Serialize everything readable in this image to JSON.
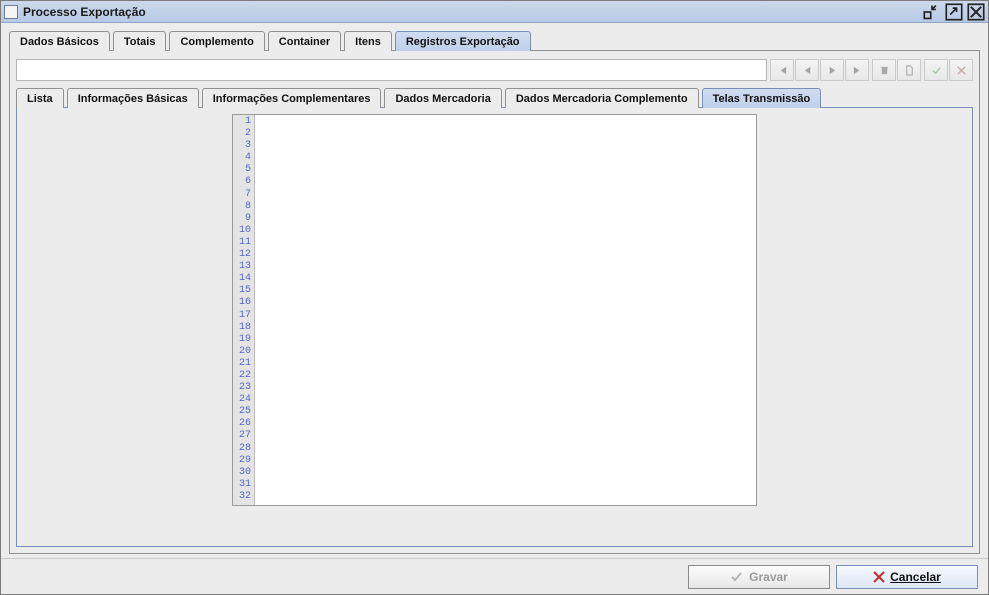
{
  "window": {
    "title": "Processo Exportação"
  },
  "mainTabs": [
    {
      "label": "Dados Básicos"
    },
    {
      "label": "Totais"
    },
    {
      "label": "Complemento"
    },
    {
      "label": "Container"
    },
    {
      "label": "Itens"
    },
    {
      "label": "Registros Exportação"
    }
  ],
  "subTabs": [
    {
      "label": "Lista"
    },
    {
      "label": "Informações Básicas"
    },
    {
      "label": "Informações Complementares"
    },
    {
      "label": "Dados Mercadoria"
    },
    {
      "label": "Dados Mercadoria Complemento"
    },
    {
      "label": "Telas Transmissão"
    }
  ],
  "editor": {
    "lineStart": 1,
    "lineEnd": 32,
    "content": ""
  },
  "footer": {
    "saveLabel": "Gravar",
    "cancelLabel": "Cancelar"
  }
}
